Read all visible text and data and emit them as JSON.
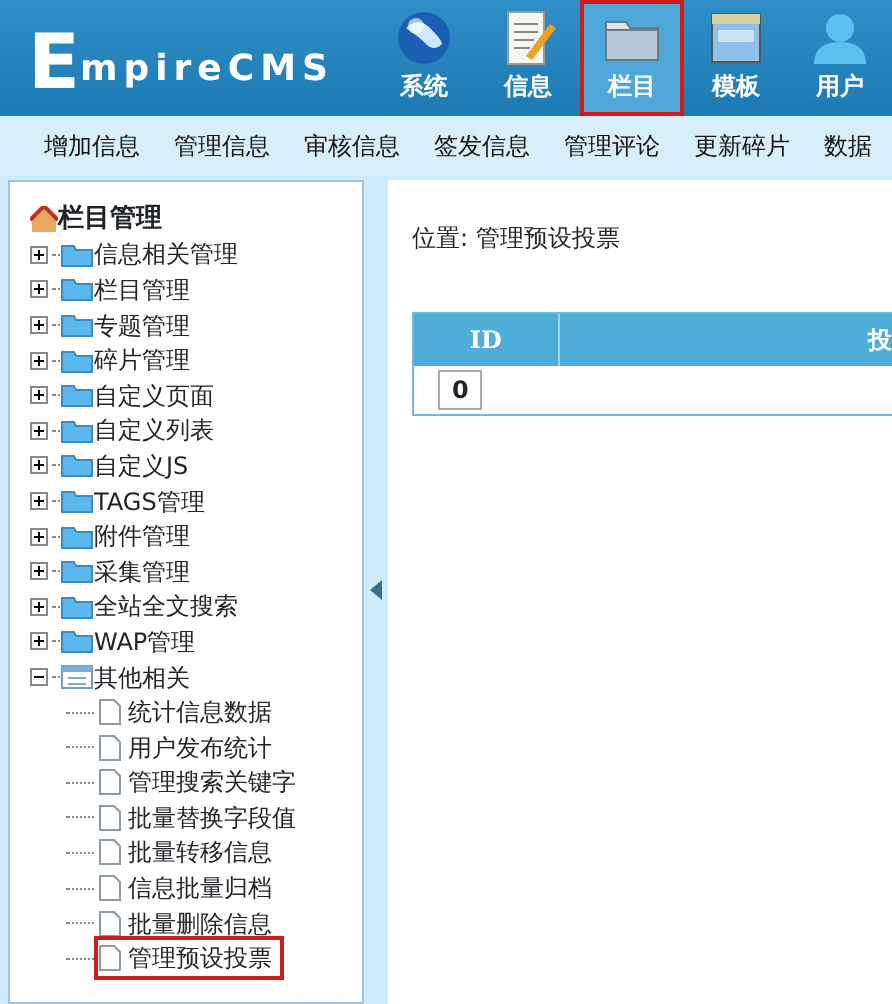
{
  "logo": {
    "initial": "E",
    "rest": "mpireCMS"
  },
  "top_nav": [
    {
      "label": "系统",
      "selected": false
    },
    {
      "label": "信息",
      "selected": false
    },
    {
      "label": "栏目",
      "selected": true
    },
    {
      "label": "模板",
      "selected": false
    },
    {
      "label": "用户",
      "selected": false
    }
  ],
  "menu": [
    "增加信息",
    "管理信息",
    "审核信息",
    "签发信息",
    "管理评论",
    "更新碎片",
    "数据"
  ],
  "tree": {
    "title": "栏目管理",
    "items": [
      {
        "label": "信息相关管理",
        "expanded": false
      },
      {
        "label": "栏目管理",
        "expanded": false
      },
      {
        "label": "专题管理",
        "expanded": false
      },
      {
        "label": "碎片管理",
        "expanded": false
      },
      {
        "label": "自定义页面",
        "expanded": false
      },
      {
        "label": "自定义列表",
        "expanded": false
      },
      {
        "label": "自定义JS",
        "expanded": false
      },
      {
        "label": "TAGS管理",
        "expanded": false
      },
      {
        "label": "附件管理",
        "expanded": false
      },
      {
        "label": "采集管理",
        "expanded": false
      },
      {
        "label": "全站全文搜索",
        "expanded": false
      },
      {
        "label": "WAP管理",
        "expanded": false
      },
      {
        "label": "其他相关",
        "expanded": true,
        "children": [
          {
            "label": "统计信息数据",
            "selected": false
          },
          {
            "label": "用户发布统计",
            "selected": false
          },
          {
            "label": "管理搜索关键字",
            "selected": false
          },
          {
            "label": "批量替换字段值",
            "selected": false
          },
          {
            "label": "批量转移信息",
            "selected": false
          },
          {
            "label": "信息批量归档",
            "selected": false
          },
          {
            "label": "批量删除信息",
            "selected": false
          },
          {
            "label": "管理预设投票",
            "selected": true
          }
        ]
      }
    ]
  },
  "location": "位置: 管理预设投票",
  "table": {
    "columns": [
      "ID",
      "投"
    ],
    "rows": [
      [
        "0"
      ]
    ]
  }
}
